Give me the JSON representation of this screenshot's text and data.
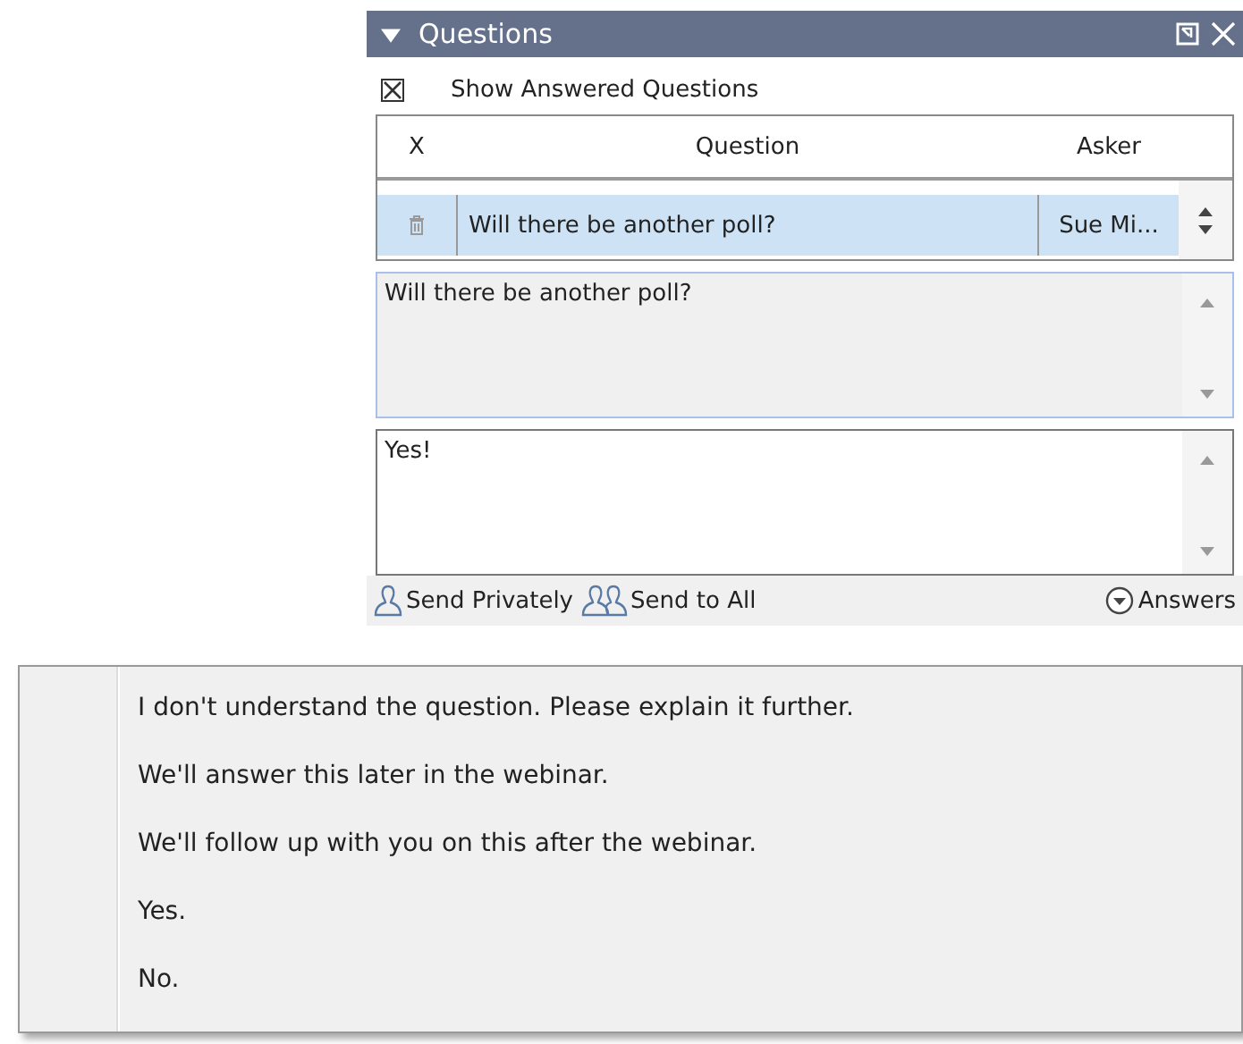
{
  "panel": {
    "title": "Questions",
    "expanded": true
  },
  "show_answered": {
    "label": "Show Answered Questions",
    "checked": true
  },
  "table": {
    "columns": [
      "X",
      "Question",
      "Asker"
    ],
    "rows": [
      {
        "question": "Will there be another poll?",
        "asker": "Sue Mi...",
        "selected": true
      }
    ]
  },
  "question_text": "Will there be another poll?",
  "answer_text": "Yes!",
  "actions": [
    {
      "kind": "private",
      "label": "Send Privately"
    },
    {
      "kind": "all",
      "label": "Send to All"
    },
    {
      "kind": "answers",
      "label": "Answers"
    }
  ],
  "answers_menu": [
    "I don't understand the question. Please explain it further.",
    "We'll answer this later in the webinar.",
    "We'll follow up with you on this after the webinar.",
    "Yes.",
    "No."
  ]
}
